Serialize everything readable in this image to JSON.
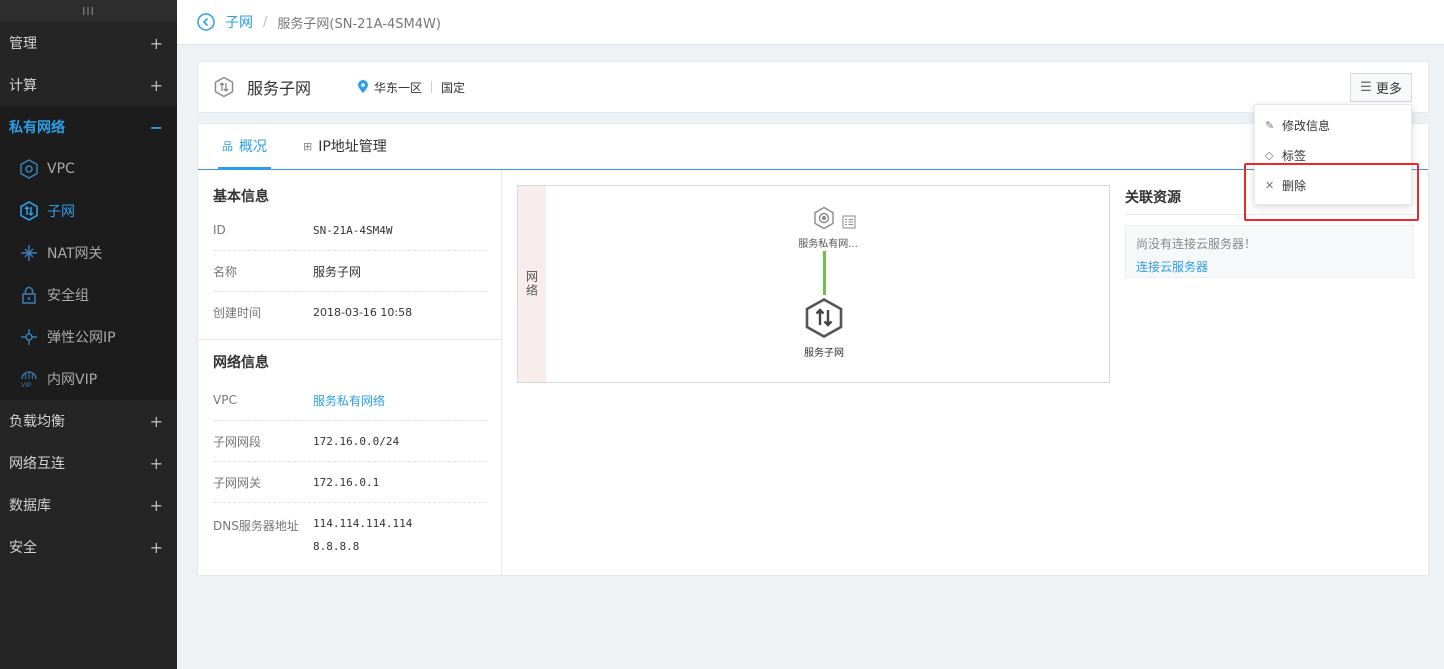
{
  "sidebar": {
    "handle": "III",
    "groups_top": [
      {
        "label": "管理",
        "toggle": "+"
      },
      {
        "label": "计算",
        "toggle": "+"
      }
    ],
    "active_group": {
      "label": "私有网络",
      "toggle": "−"
    },
    "items": [
      {
        "label": "VPC",
        "icon": "vpc-hexagon-icon"
      },
      {
        "label": "子网",
        "icon": "subnet-icon"
      },
      {
        "label": "NAT网关",
        "icon": "nat-gateway-icon"
      },
      {
        "label": "安全组",
        "icon": "lock-icon"
      },
      {
        "label": "弹性公网IP",
        "icon": "elastic-ip-icon"
      },
      {
        "label": "内网VIP",
        "icon": "vip-globe-icon"
      }
    ],
    "groups_bottom": [
      {
        "label": "负载均衡",
        "toggle": "+"
      },
      {
        "label": "网络互连",
        "toggle": "+"
      },
      {
        "label": "数据库",
        "toggle": "+"
      },
      {
        "label": "安全",
        "toggle": "+"
      }
    ]
  },
  "breadcrumb": {
    "parent": "子网",
    "separator": "/",
    "current": "服务子网(SN-21A-4SM4W)"
  },
  "header": {
    "title": "服务子网",
    "region": "华东一区",
    "type": "国定",
    "more_label": "更多"
  },
  "tabs": [
    {
      "label": "概况",
      "icon": "overview-icon"
    },
    {
      "label": "IP地址管理",
      "icon": "ip-manage-icon"
    }
  ],
  "basic": {
    "title": "基本信息",
    "rows": [
      {
        "key": "ID",
        "value": "SN-21A-4SM4W"
      },
      {
        "key": "名称",
        "value": "服务子网"
      },
      {
        "key": "创建时间",
        "value": "2018-03-16 10:58"
      }
    ]
  },
  "network": {
    "title": "网络信息",
    "vpc_key": "VPC",
    "vpc_value": "服务私有网络",
    "cidr_key": "子网网段",
    "cidr_value": "172.16.0.0/24",
    "gw_key": "子网网关",
    "gw_value": "172.16.0.1",
    "dns_key": "DNS服务器地址",
    "dns_values": [
      "114.114.114.114",
      "8.8.8.8"
    ]
  },
  "topology": {
    "band_label": "网络",
    "vpc_label": "服务私有网...",
    "subnet_label": "服务子网"
  },
  "related": {
    "title": "关联资源",
    "empty": "尚没有连接云服务器！",
    "connect": "连接云服务器"
  },
  "dropdown": [
    {
      "label": "修改信息",
      "icon": "edit-icon"
    },
    {
      "label": "标签",
      "icon": "tag-icon"
    },
    {
      "label": "删除",
      "icon": "close-icon"
    }
  ],
  "colors": {
    "accent": "#2d9ee8",
    "sidebar_bg": "#252526",
    "highlight": "#e82a2a",
    "link_line": "#6dc244"
  }
}
